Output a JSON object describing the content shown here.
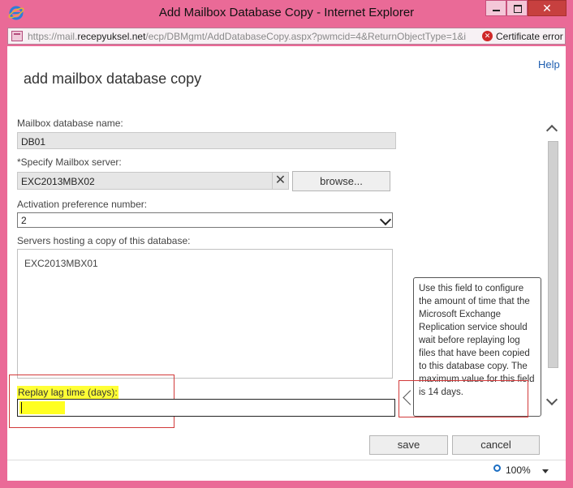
{
  "window": {
    "title": "Add Mailbox Database Copy - Internet Explorer",
    "close_glyph": "✕"
  },
  "address_bar": {
    "url_prefix": "https://mail.",
    "url_domain": "recepyuksel.net",
    "url_suffix": "/ecp/DBMgmt/AddDatabaseCopy.aspx?pwmcid=4&ReturnObjectType=1&i",
    "certificate_error": "Certificate error"
  },
  "page": {
    "help": "Help",
    "title": "add mailbox database copy"
  },
  "form": {
    "db_name_label": "Mailbox database name:",
    "db_name_value": "DB01",
    "server_label": "*Specify Mailbox server:",
    "server_value": "EXC2013MBX02",
    "clear_glyph": "✕",
    "browse_label": "browse...",
    "activation_label": "Activation preference number:",
    "activation_value": "2",
    "servers_label": "Servers hosting a copy of this database:",
    "servers": [
      "EXC2013MBX01"
    ],
    "lag_label": "Replay lag time (days):",
    "lag_value": ""
  },
  "tooltip": {
    "text": "Use this field to configure the amount of time that the Microsoft Exchange Replication service should wait before replaying log files that have been copied to this database copy. The maximum value for this field is 14 days."
  },
  "buttons": {
    "save": "save",
    "cancel": "cancel"
  },
  "status_bar": {
    "zoom": "100%"
  },
  "colors": {
    "window_frame": "#ea6a97",
    "highlight": "#ffff35",
    "annotation_red": "#d23a3a",
    "link_blue": "#1e5eb0"
  },
  "icons": [
    "ie-logo-icon",
    "page-icon",
    "certificate-error-icon",
    "clear-icon",
    "chevron-down-icon",
    "scroll-up-icon",
    "scroll-down-icon",
    "zoom-icon"
  ]
}
